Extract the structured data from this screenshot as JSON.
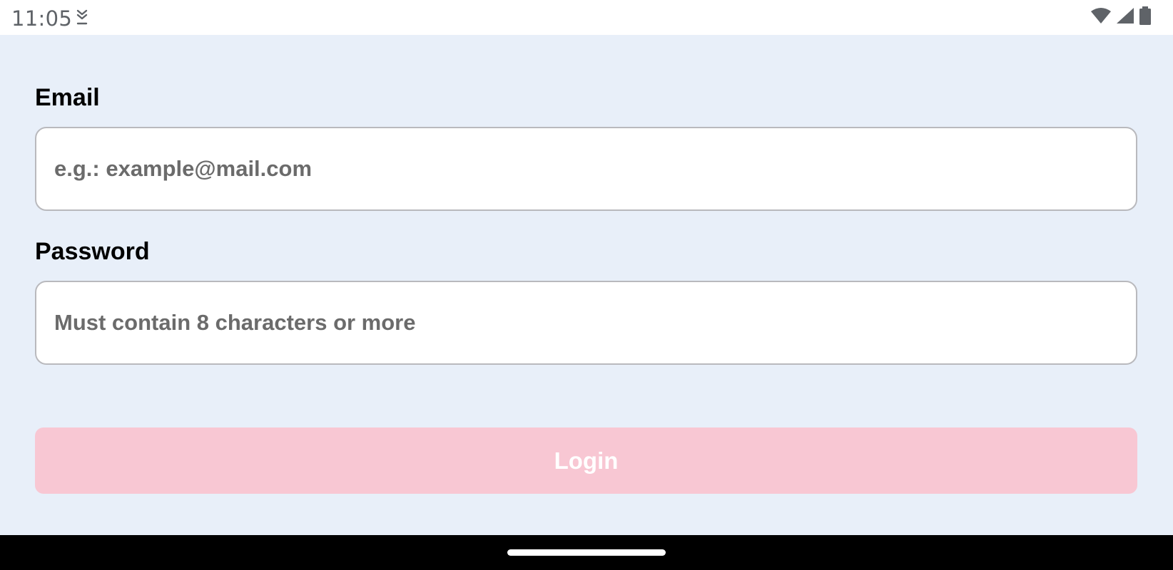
{
  "status_bar": {
    "time": "11:05",
    "notification_icon": "download-arrow-icon",
    "icons": [
      "wifi-icon",
      "cell-signal-icon",
      "battery-icon"
    ]
  },
  "form": {
    "email": {
      "label": "Email",
      "placeholder": "e.g.: example@mail.com",
      "value": ""
    },
    "password": {
      "label": "Password",
      "placeholder": "Must contain 8 characters or more",
      "value": ""
    },
    "login_label": "Login"
  },
  "colors": {
    "background": "#e8eff9",
    "button_disabled": "#f8c7d3",
    "input_border": "#b9b9bd"
  }
}
